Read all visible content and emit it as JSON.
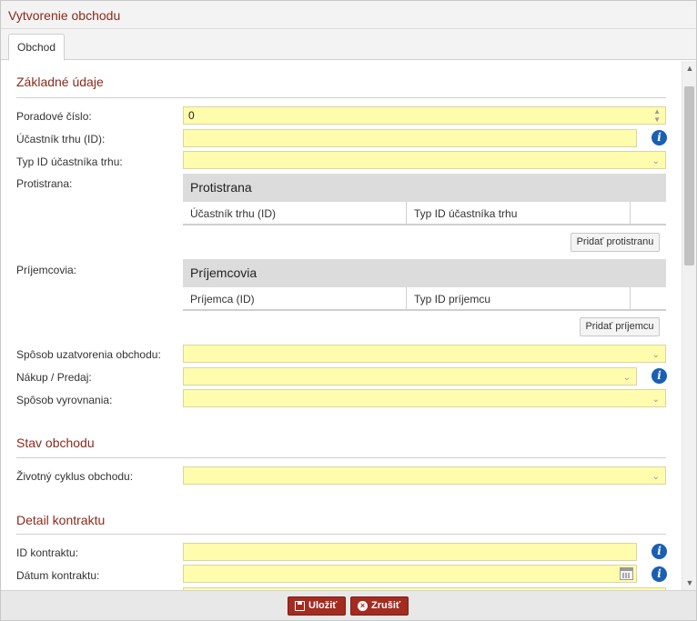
{
  "window": {
    "title": "Vytvorenie obchodu"
  },
  "tabs": [
    {
      "label": "Obchod",
      "active": true
    }
  ],
  "sections": {
    "basic": {
      "title": "Základné údaje"
    },
    "state": {
      "title": "Stav obchodu"
    },
    "contract": {
      "title": "Detail kontraktu"
    }
  },
  "fields": {
    "order_number": {
      "label": "Poradové číslo:",
      "value": "0"
    },
    "market_participant": {
      "label": "Účastník trhu (ID):",
      "value": ""
    },
    "participant_id_type": {
      "label": "Typ ID účastníka trhu:",
      "value": ""
    },
    "counterparty": {
      "label": "Protistrana:"
    },
    "recipients": {
      "label": "Príjemcovia:"
    },
    "closing_method": {
      "label": "Spôsob uzatvorenia obchodu:",
      "value": ""
    },
    "buy_sell": {
      "label": "Nákup / Predaj:",
      "value": ""
    },
    "settlement_method": {
      "label": "Spôsob vyrovnania:",
      "value": ""
    },
    "lifecycle": {
      "label": "Životný cyklus obchodu:",
      "value": ""
    },
    "contract_id": {
      "label": "ID kontraktu:",
      "value": ""
    },
    "contract_date": {
      "label": "Dátum kontraktu:",
      "value": ""
    }
  },
  "counterparty_table": {
    "header": "Protistrana",
    "columns": [
      "Účastník trhu (ID)",
      "Typ ID účastníka trhu",
      ""
    ],
    "add_button": "Pridať protistranu"
  },
  "recipients_table": {
    "header": "Príjemcovia",
    "columns": [
      "Príjemca (ID)",
      "Typ ID príjemcu",
      ""
    ],
    "add_button": "Pridať príjemcu"
  },
  "footer": {
    "save_label": "Uložiť",
    "cancel_label": "Zrušiť"
  },
  "colors": {
    "accent": "#a32b20",
    "title_text": "#8a2a1c",
    "field_bg": "#fffcad",
    "info_icon": "#1a5fb4"
  },
  "icons": {
    "info": "info-icon",
    "calendar": "calendar-icon",
    "save": "save-icon",
    "cancel": "cancel-icon"
  }
}
